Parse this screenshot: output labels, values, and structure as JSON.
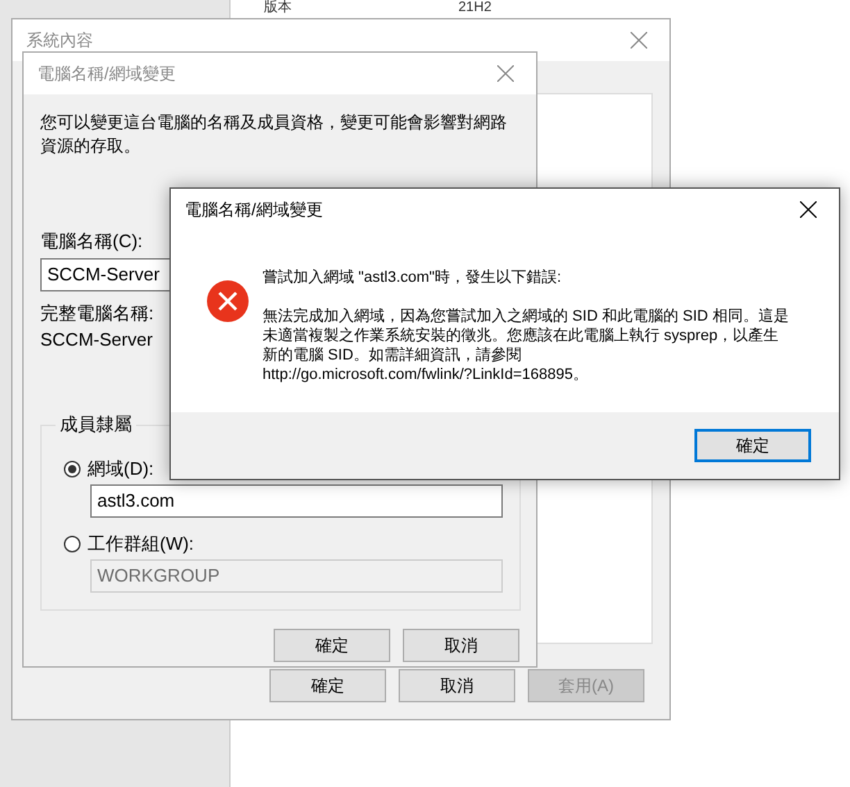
{
  "background": {
    "version_label": "版本",
    "version_value": "21H2"
  },
  "system_properties": {
    "title": "系統內容",
    "buttons": [
      {
        "label": "確定",
        "disabled": false
      },
      {
        "label": "取消",
        "disabled": false
      },
      {
        "label": "套用(A)",
        "disabled": true
      }
    ]
  },
  "name_dialog": {
    "title": "電腦名稱/網域變更",
    "description": "您可以變更這台電腦的名稱及成員資格，變更可能會影響對網路資源的存取。",
    "computer_name_label": "電腦名稱(C):",
    "computer_name": "SCCM-Server",
    "full_name_label": "完整電腦名稱:",
    "full_name": "SCCM-Server",
    "membership": {
      "title": "成員隸屬",
      "options": [
        {
          "label": "網域(D):",
          "selected": true,
          "value": "astl3.com"
        },
        {
          "label": "工作群組(W):",
          "selected": false,
          "value": "WORKGROUP"
        }
      ]
    },
    "buttons": [
      {
        "label": "確定",
        "disabled": false
      },
      {
        "label": "取消",
        "disabled": false
      }
    ]
  },
  "error_dialog": {
    "title": "電腦名稱/網域變更",
    "heading": "嘗試加入網域 \"astl3.com\"時，發生以下錯誤:",
    "message_lines": [
      "無法完成加入網域，因為您嘗試加入之網域的 SID 和此電腦的 SID 相同。這是",
      "未適當複製之作業系統安裝的徵兆。您應該在此電腦上執行 sysprep，以產生",
      "新的電腦 SID。如需詳細資訊，請參閱",
      "http://go.microsoft.com/fwlink/?LinkId=168895。"
    ],
    "buttons": [
      {
        "label": "確定",
        "default": true
      }
    ]
  }
}
